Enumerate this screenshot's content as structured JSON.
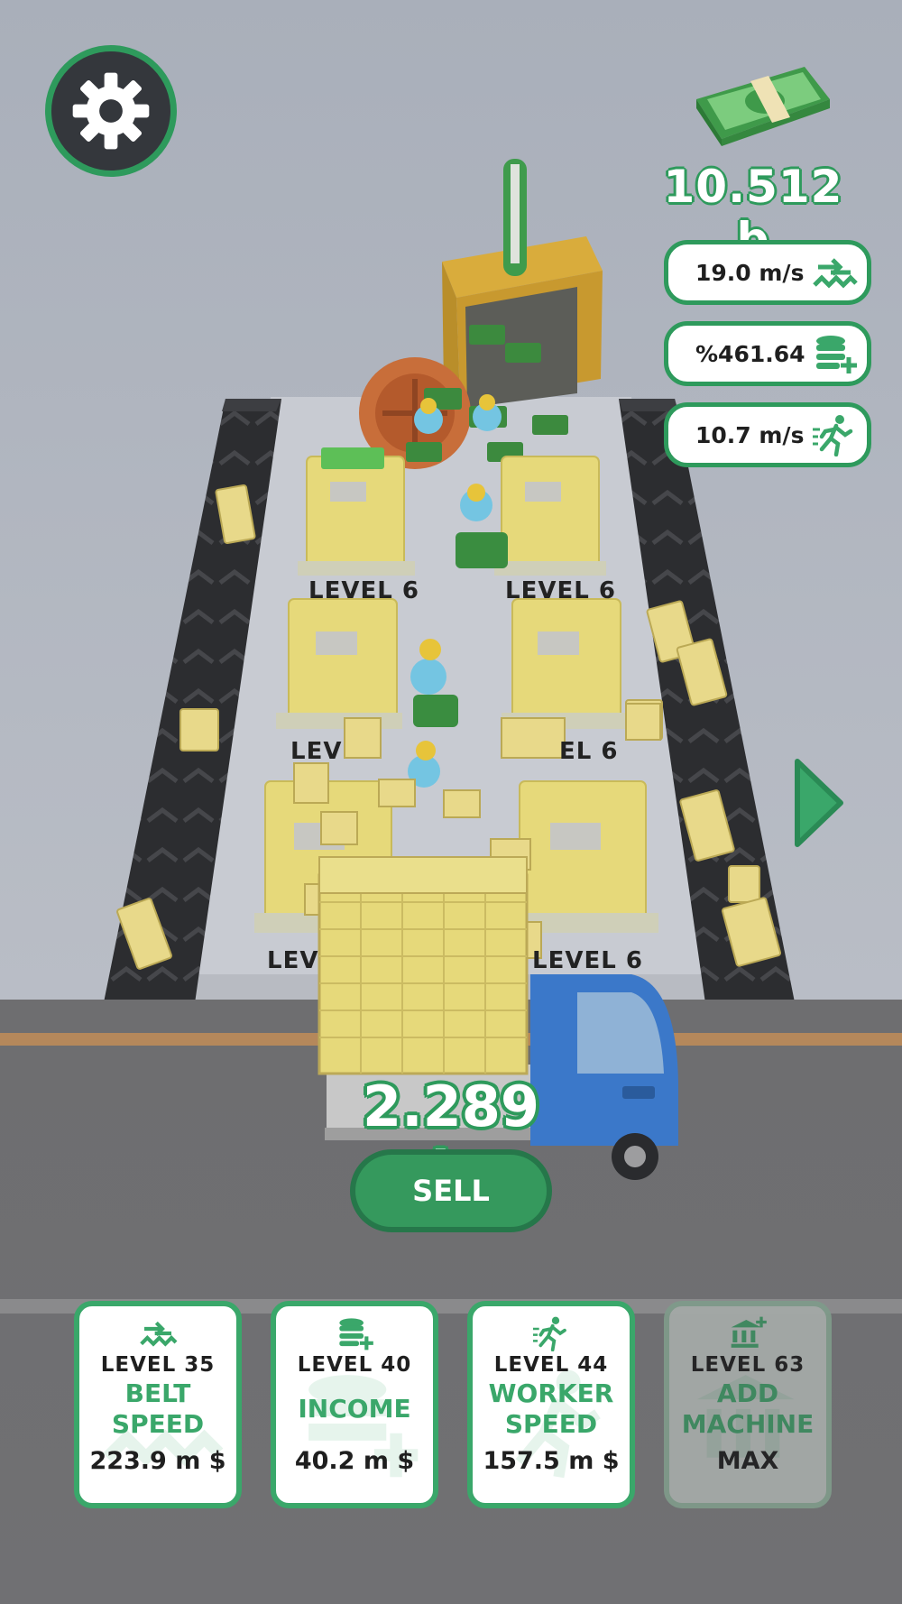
{
  "hud": {
    "cash_total": "10.512 b",
    "stats": [
      {
        "value": "19.0 m/s",
        "icon": "belt-speed-icon"
      },
      {
        "value": "%461.64",
        "icon": "income-coins-icon"
      },
      {
        "value": "10.7 m/s",
        "icon": "worker-run-icon"
      }
    ]
  },
  "machines": {
    "labels": [
      "LEVEL 6",
      "LEVEL 6",
      "LEV",
      "EL 6",
      "LEV",
      "LEVEL 6"
    ]
  },
  "truck": {
    "amount": "2.289 b",
    "sell_label": "SELL"
  },
  "upgrades": [
    {
      "level": "LEVEL 35",
      "title_line1": "BELT",
      "title_line2": "SPEED",
      "price": "223.9 m $",
      "icon": "belt-speed-icon",
      "maxed": false
    },
    {
      "level": "LEVEL 40",
      "title_line1": "INCOME",
      "title_line2": "",
      "price": "40.2 m $",
      "icon": "income-coins-icon",
      "maxed": false
    },
    {
      "level": "LEVEL 44",
      "title_line1": "WORKER",
      "title_line2": "SPEED",
      "price": "157.5 m $",
      "icon": "worker-run-icon",
      "maxed": false
    },
    {
      "level": "LEVEL 63",
      "title_line1": "ADD",
      "title_line2": "MACHINE",
      "price": "MAX",
      "icon": "add-machine-icon",
      "maxed": true
    }
  ],
  "colors": {
    "accent_green": "#2e9a5c",
    "card_green": "#3aa76a",
    "belt": "#2b2c2f",
    "machine_yellow": "#e6d97a",
    "truck_blue": "#3b78c9",
    "road": "#6d6d6f",
    "floor": "#bcc0c8"
  }
}
